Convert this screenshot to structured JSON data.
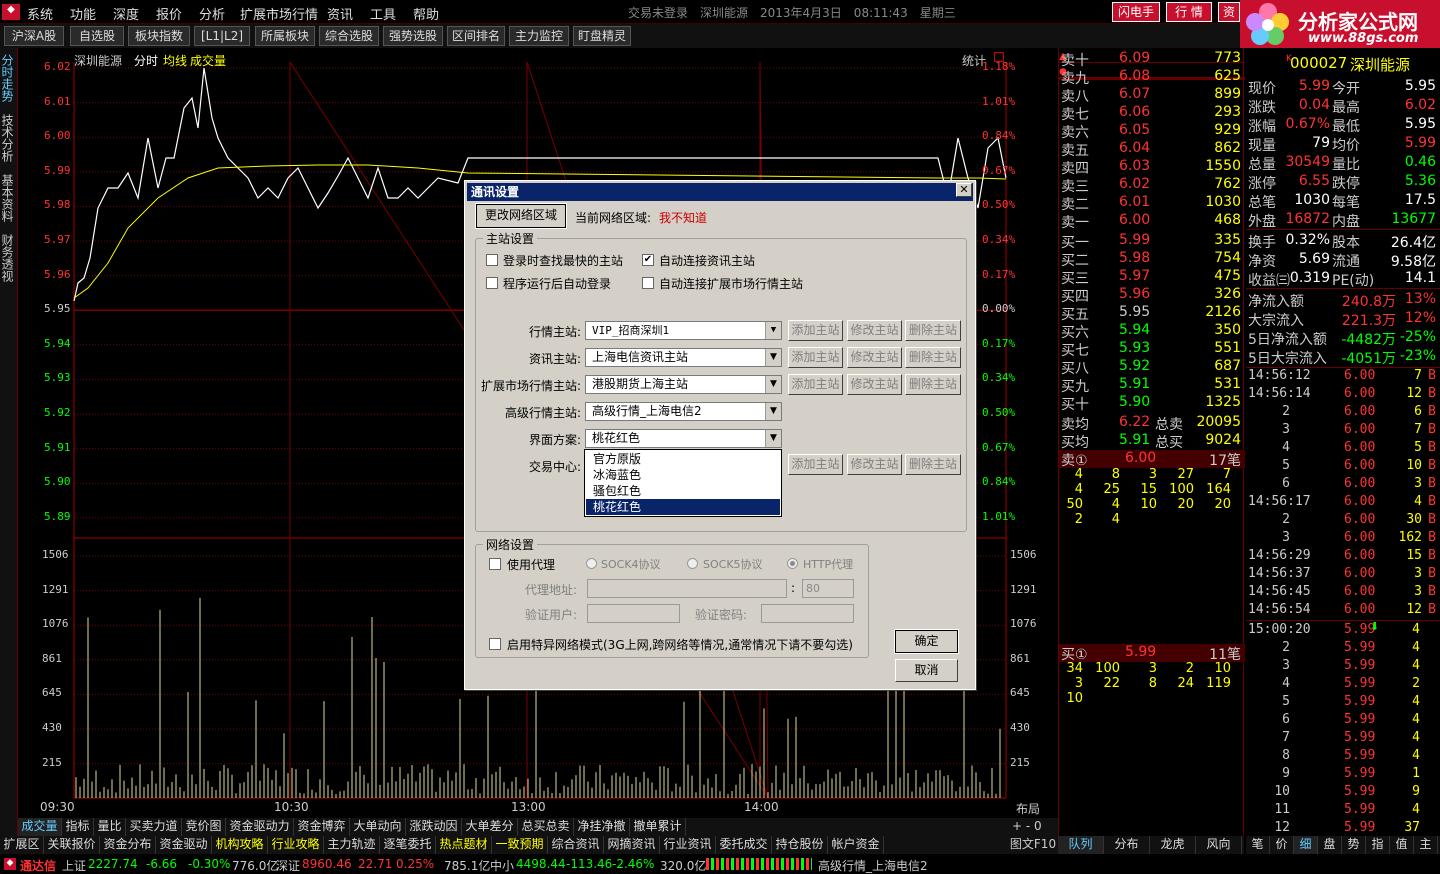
{
  "menu": {
    "items": [
      "系统",
      "功能",
      "深度",
      "报价",
      "分析",
      "扩展市场行情",
      "资讯",
      "工具",
      "帮助"
    ]
  },
  "titlebar": {
    "text": "交易未登录　深圳能源　2013年4月3日　08:11:43　星期三",
    "flash_btn": "闪电手",
    "quote_btn": "行 情",
    "zi_btn": "资"
  },
  "logo": {
    "name": "分析家公式网",
    "url": "www.88gs.com"
  },
  "toolbar": {
    "items": [
      "沪深A股",
      "自选股",
      "板块指数",
      "[L1|L2]",
      "所属板块",
      "综合选股",
      "强势选股",
      "区间排名",
      "主力监控",
      "盯盘精灵"
    ]
  },
  "vtabs": [
    "分时走势",
    "技术分析",
    "基本资料",
    "财务透视"
  ],
  "chart": {
    "name": "深圳能源",
    "mode": "分时",
    "avg_label": "均线",
    "vol_label": "成交量",
    "stat_label": "统计",
    "price_ticks": [
      "6.02",
      "6.01",
      "6.00",
      "5.99",
      "5.98",
      "5.97",
      "5.96",
      "5.95",
      "5.94",
      "5.93",
      "5.92",
      "5.91",
      "5.90",
      "5.89"
    ],
    "pct_ticks": [
      "1.18%",
      "1.01%",
      "0.84%",
      "0.67%",
      "0.50%",
      "0.34%",
      "0.17%",
      "0.00%",
      "0.17%",
      "0.34%",
      "0.50%",
      "0.67%",
      "0.84%",
      "1.01%"
    ],
    "vol_ticks": [
      "1506",
      "1291",
      "1076",
      "861",
      "645",
      "430",
      "215"
    ],
    "time_ticks": [
      "09:30",
      "10:30",
      "13:00",
      "14:00"
    ],
    "layout_label": "布局",
    "zoom_label": "+ -  0"
  },
  "orderbook": {
    "asks": [
      {
        "label": "卖十",
        "price": "6.09",
        "vol": "773"
      },
      {
        "label": "卖九",
        "price": "6.08",
        "vol": "625"
      },
      {
        "label": "卖八",
        "price": "6.07",
        "vol": "899"
      },
      {
        "label": "卖七",
        "price": "6.06",
        "vol": "293"
      },
      {
        "label": "卖六",
        "price": "6.05",
        "vol": "929"
      },
      {
        "label": "卖五",
        "price": "6.04",
        "vol": "862"
      },
      {
        "label": "卖四",
        "price": "6.03",
        "vol": "1550"
      },
      {
        "label": "卖三",
        "price": "6.02",
        "vol": "762"
      },
      {
        "label": "卖二",
        "price": "6.01",
        "vol": "1030"
      },
      {
        "label": "卖一",
        "price": "6.00",
        "vol": "468"
      }
    ],
    "bids": [
      {
        "label": "买一",
        "price": "5.99",
        "vol": "335"
      },
      {
        "label": "买二",
        "price": "5.98",
        "vol": "754"
      },
      {
        "label": "买三",
        "price": "5.97",
        "vol": "475"
      },
      {
        "label": "买四",
        "price": "5.96",
        "vol": "326"
      },
      {
        "label": "买五",
        "price": "5.95",
        "vol": "2126"
      },
      {
        "label": "买六",
        "price": "5.94",
        "vol": "350"
      },
      {
        "label": "买七",
        "price": "5.93",
        "vol": "551"
      },
      {
        "label": "买八",
        "price": "5.92",
        "vol": "687"
      },
      {
        "label": "买九",
        "price": "5.91",
        "vol": "531"
      },
      {
        "label": "买十",
        "price": "5.90",
        "vol": "1325"
      }
    ],
    "avg_sell": {
      "label": "卖均",
      "price": "6.22",
      "total_label": "总卖",
      "total": "20095"
    },
    "avg_buy": {
      "label": "买均",
      "price": "5.91",
      "total_label": "总买",
      "total": "9024"
    },
    "sell1": {
      "label": "卖①",
      "price": "6.00",
      "count": "17笔",
      "queue": [
        [
          "4",
          "8",
          "3",
          "27",
          "7"
        ],
        [
          "4",
          "25",
          "15",
          "100",
          "164"
        ],
        [
          "50",
          "4",
          "10",
          "20",
          "20"
        ],
        [
          "2",
          "4",
          "",
          "",
          ""
        ]
      ]
    },
    "buy1": {
      "label": "买①",
      "price": "5.99",
      "count": "11笔",
      "queue": [
        [
          "34",
          "100",
          "3",
          "2",
          "10"
        ],
        [
          "3",
          "22",
          "8",
          "24",
          "119"
        ],
        [
          "10",
          "",
          "",
          "",
          ""
        ]
      ]
    }
  },
  "quote": {
    "code": "000027",
    "name": "深圳能源",
    "rows": [
      [
        "现价",
        "5.99",
        "今开",
        "5.95"
      ],
      [
        "涨跌",
        "0.04",
        "最高",
        "6.02"
      ],
      [
        "涨幅",
        "0.67%",
        "最低",
        "5.95"
      ],
      [
        "现量",
        "79",
        "均价",
        "5.99"
      ],
      [
        "总量",
        "30549",
        "量比",
        "0.46"
      ],
      [
        "涨停",
        "6.55",
        "跌停",
        "5.36"
      ],
      [
        "总笔",
        "1030",
        "每笔",
        "17.5"
      ],
      [
        "外盘",
        "16872",
        "内盘",
        "13677"
      ],
      [
        "换手",
        "0.32%",
        "股本",
        "26.4亿"
      ],
      [
        "净资",
        "5.69",
        "流通",
        "9.58亿"
      ],
      [
        "收益㈢",
        "0.319",
        "PE(动)",
        "14.1"
      ]
    ],
    "flows": [
      [
        "净流入额",
        "240.8万",
        "13%"
      ],
      [
        "大宗流入",
        "221.3万",
        "12%"
      ],
      [
        "5日净流入额",
        "-4482万",
        "-25%"
      ],
      [
        "5日大宗流入",
        "-4051万",
        "-23%"
      ]
    ]
  },
  "ticks": [
    [
      "14:56:12",
      "6.00",
      "7",
      "B"
    ],
    [
      "14:56:14",
      "6.00",
      "12",
      "B"
    ],
    [
      "2",
      "6.00",
      "6",
      "B"
    ],
    [
      "3",
      "6.00",
      "7",
      "B"
    ],
    [
      "4",
      "6.00",
      "5",
      "B"
    ],
    [
      "5",
      "6.00",
      "10",
      "B"
    ],
    [
      "6",
      "6.00",
      "3",
      "B"
    ],
    [
      "14:56:17",
      "6.00",
      "4",
      "B"
    ],
    [
      "2",
      "6.00",
      "30",
      "B"
    ],
    [
      "3",
      "6.00",
      "162",
      "B"
    ],
    [
      "14:56:29",
      "6.00",
      "15",
      "B"
    ],
    [
      "14:56:37",
      "6.00",
      "3",
      "B"
    ],
    [
      "14:56:45",
      "6.00",
      "3",
      "B"
    ],
    [
      "14:56:54",
      "6.00",
      "12",
      "B"
    ],
    [
      "15:00:20",
      "5.99",
      "4",
      ""
    ],
    [
      "2",
      "5.99",
      "4",
      ""
    ],
    [
      "3",
      "5.99",
      "4",
      ""
    ],
    [
      "4",
      "5.99",
      "2",
      ""
    ],
    [
      "5",
      "5.99",
      "4",
      ""
    ],
    [
      "6",
      "5.99",
      "4",
      ""
    ],
    [
      "7",
      "5.99",
      "4",
      ""
    ],
    [
      "8",
      "5.99",
      "4",
      ""
    ],
    [
      "9",
      "5.99",
      "1",
      ""
    ],
    [
      "10",
      "5.99",
      "9",
      ""
    ],
    [
      "11",
      "5.99",
      "4",
      ""
    ],
    [
      "12",
      "5.99",
      "37",
      ""
    ]
  ],
  "right_tabs_mid": [
    "队列",
    "分布",
    "龙虎",
    "风向"
  ],
  "right_tabs_far": [
    "笔",
    "价",
    "细",
    "盘",
    "势",
    "指",
    "值",
    "主"
  ],
  "bottom_tabs1": [
    "成交量",
    "指标",
    "量比",
    "买卖力道",
    "竞价图",
    "资金驱动力",
    "资金博弈",
    "大单动向",
    "涨跌动因",
    "大单差分",
    "总买总卖",
    "净挂净撤",
    "撤单累计"
  ],
  "bottom_tabs2": [
    "扩展区",
    "关联报价",
    "资金分布",
    "资金驱动",
    "机构攻略",
    "行业攻略",
    "主力轨迹",
    "逐笔委托",
    "热点题材",
    "一致预期",
    "综合资讯",
    "网摘资讯",
    "行业资讯",
    "委托成交",
    "持仓股份",
    "帐户资金"
  ],
  "bottom_right": "图文F10",
  "status": {
    "brand": "通达信",
    "sh_label": "上证",
    "sh": "2227.74",
    "sh_chg": "-6.66",
    "sh_pct": "-0.30%",
    "sh_amt": "776.0亿",
    "sz_label": "深证",
    "sz": "8960.46",
    "sz_chg": "22.71",
    "sz_pct": "0.25%",
    "sz_amt": "785.1亿",
    "zx_label": "中小",
    "zx": "4498.44",
    "zx_chg": "-113.46",
    "zx_pct": "-2.46%",
    "zx_amt": "320.0亿",
    "server": "高级行情_上海电信2"
  },
  "dialog": {
    "title": "通讯设置",
    "change_area_btn": "更改网络区域",
    "cur_area_label": "当前网络区域:",
    "cur_area_value": "我不知道",
    "main_group": "主站设置",
    "chk1": "登录时查找最快的主站",
    "chk2": "自动连接资讯主站",
    "chk3": "程序运行后自动登录",
    "chk4": "自动连接扩展市场行情主站",
    "rows": [
      {
        "label": "行情主站:",
        "value": "VIP_招商深圳1"
      },
      {
        "label": "资讯主站:",
        "value": "上海电信资讯主站"
      },
      {
        "label": "扩展市场行情主站:",
        "value": "港股期货上海主站"
      },
      {
        "label": "高级行情主站:",
        "value": "高级行情_上海电信2"
      },
      {
        "label": "界面方案:",
        "value": "桃花红色"
      },
      {
        "label": "交易中心:",
        "value": ""
      }
    ],
    "add_btn": "添加主站",
    "edit_btn": "修改主站",
    "del_btn": "删除主站",
    "dropdown": [
      "官方原版",
      "冰海蓝色",
      "骚包红色",
      "桃花红色"
    ],
    "net_group": "网络设置",
    "use_proxy": "使用代理",
    "sock4": "SOCK4协议",
    "sock5": "SOCK5协议",
    "http": "HTTP代理",
    "proxy_addr": "代理地址:",
    "proxy_port": "80",
    "verify_user": "验证用户:",
    "verify_pwd": "验证密码:",
    "special_mode": "启用特异网络模式(3G上网,跨网络等情况,通常情况下请不要勾选)",
    "ok": "确定",
    "cancel": "取消"
  }
}
